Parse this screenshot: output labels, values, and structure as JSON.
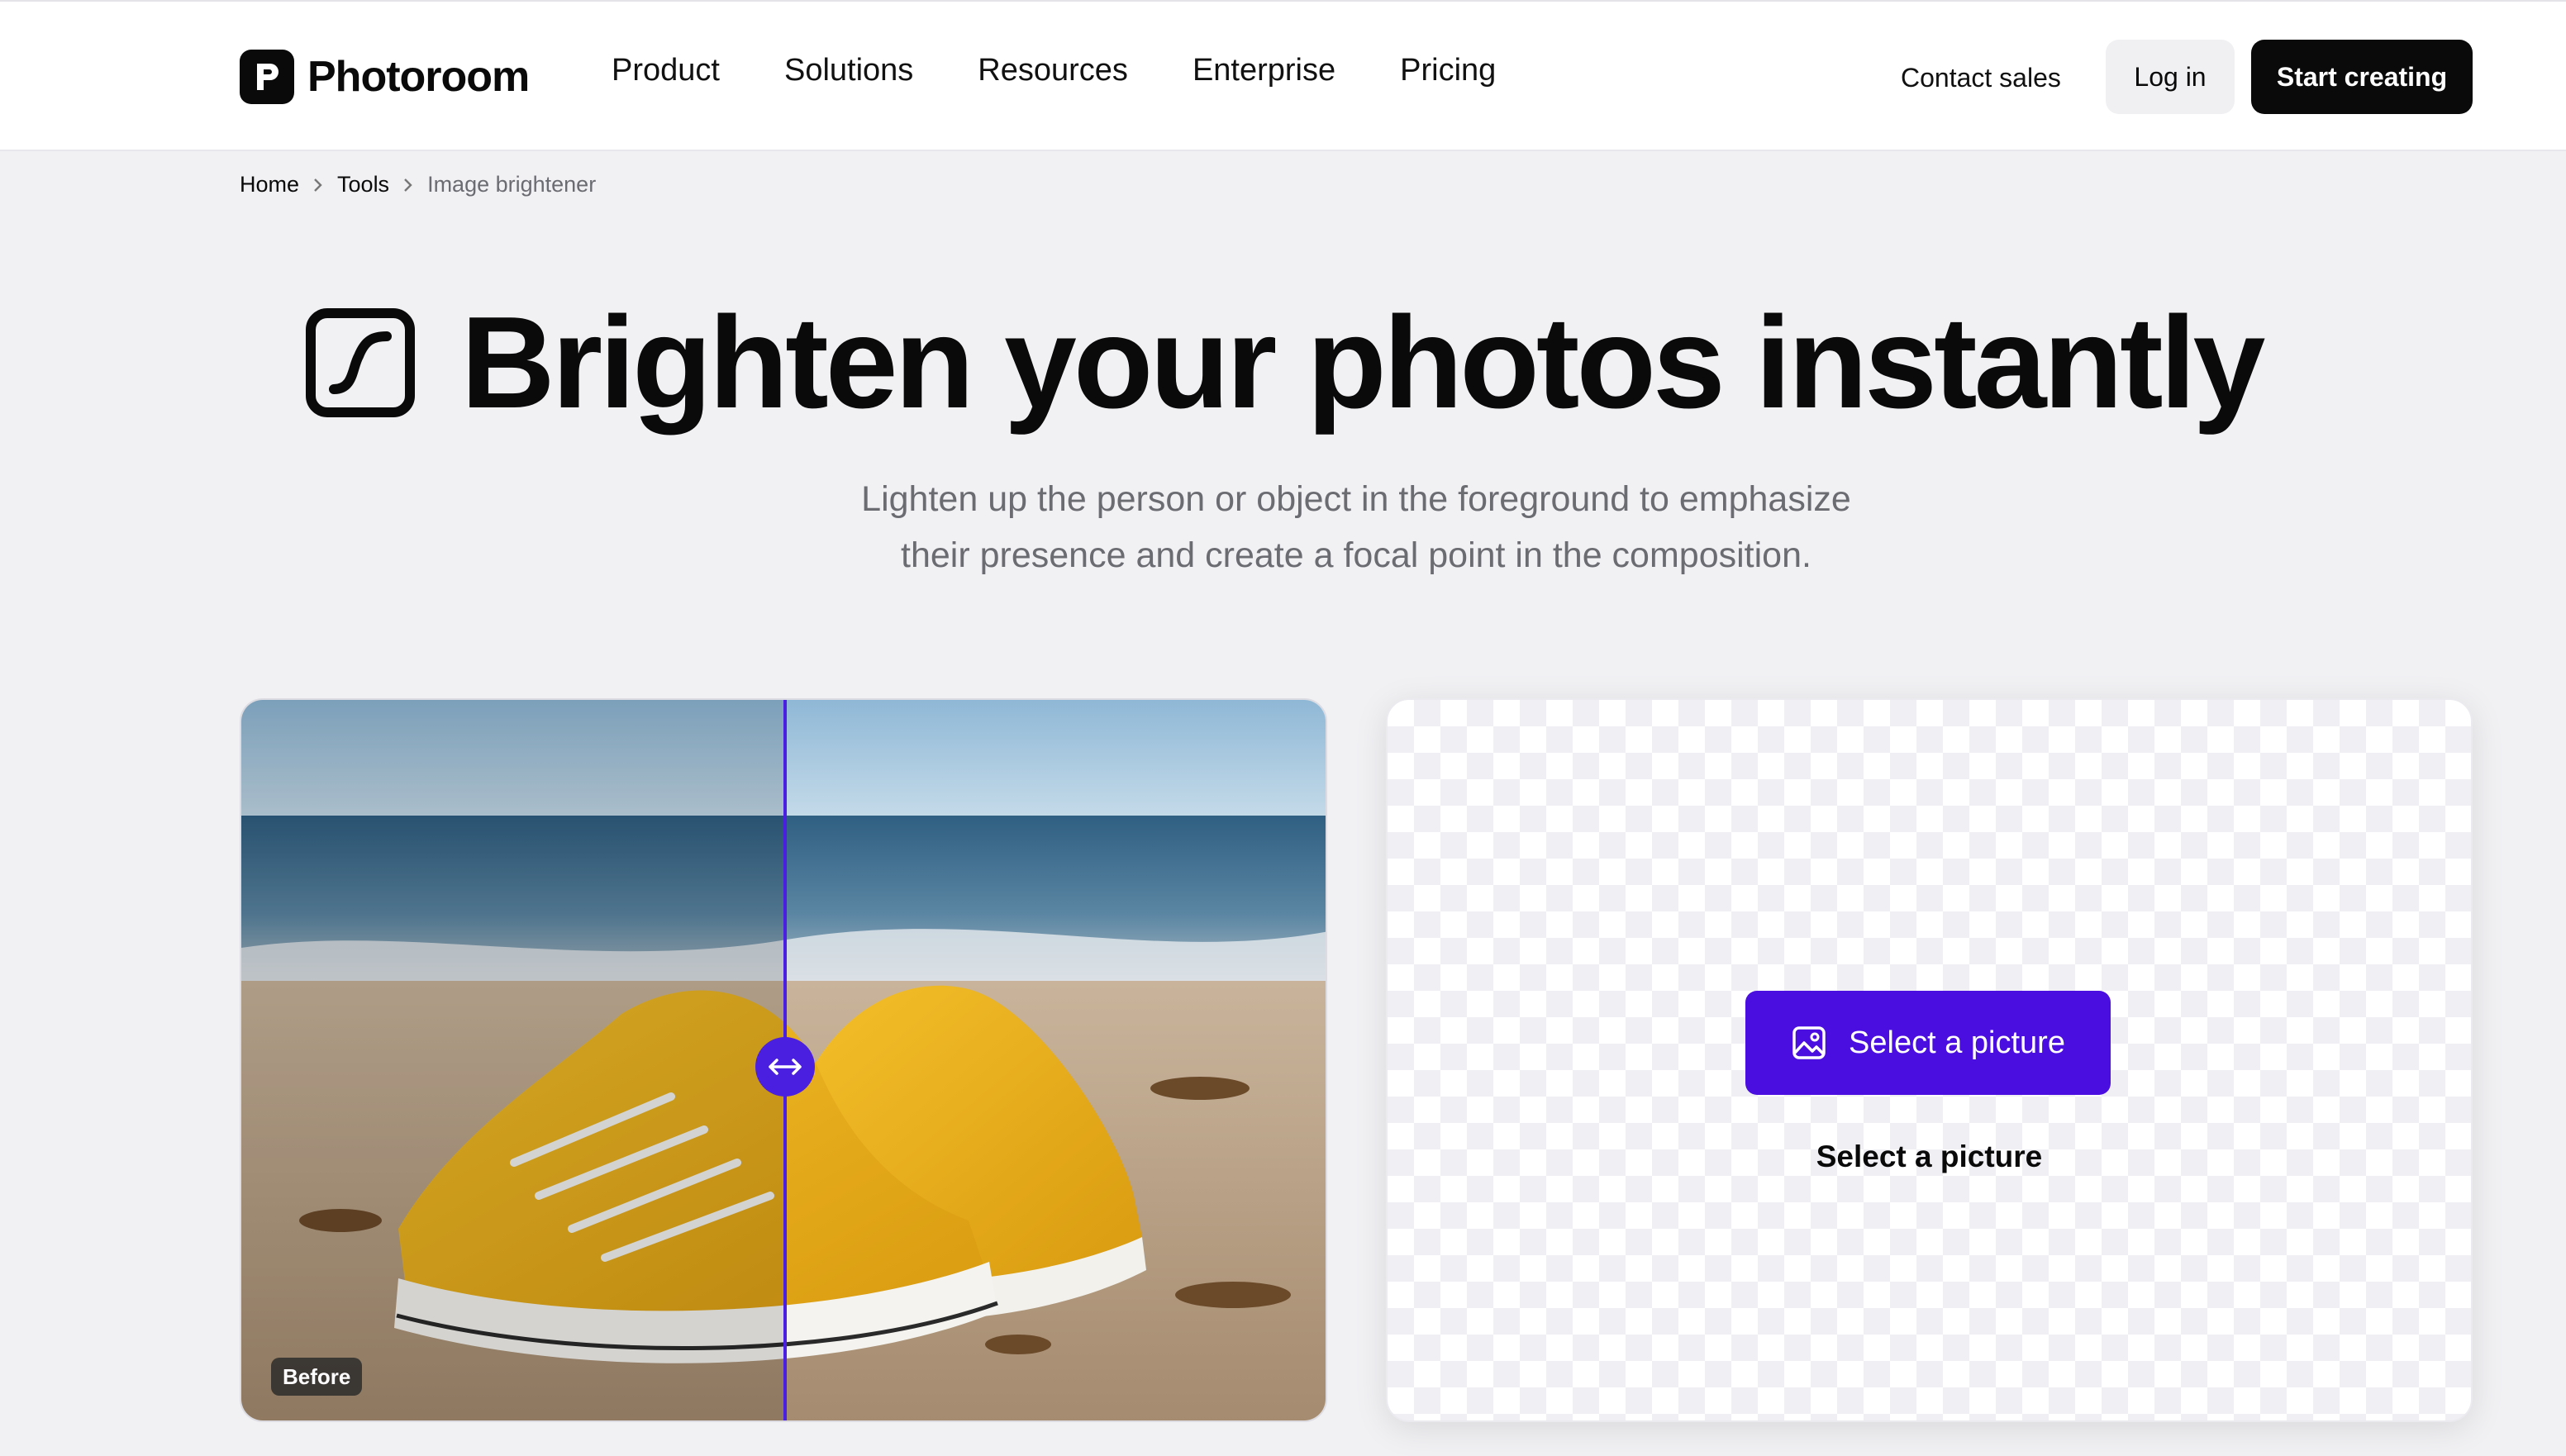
{
  "header": {
    "brand": "Photoroom",
    "nav": [
      "Product",
      "Solutions",
      "Resources",
      "Enterprise",
      "Pricing"
    ],
    "contact_sales": "Contact sales",
    "login": "Log in",
    "start": "Start creating"
  },
  "breadcrumb": {
    "home": "Home",
    "tools": "Tools",
    "current": "Image brightener"
  },
  "hero": {
    "title": "Brighten your photos instantly",
    "subtitle_line1": "Lighten up the person or object in the foreground to emphasize",
    "subtitle_line2": "their presence and create a focal point in the composition."
  },
  "compare": {
    "before_label": "Before"
  },
  "upload": {
    "button_label": "Select a picture",
    "caption": "Select a picture"
  },
  "colors": {
    "accent": "#4a0ee0",
    "dark": "#0a0a0a",
    "background": "#f1f1f4"
  },
  "icons": [
    "photoroom-logo-icon",
    "brightness-curve-icon",
    "chevron-right-icon",
    "arrows-horizontal-icon",
    "image-icon"
  ]
}
